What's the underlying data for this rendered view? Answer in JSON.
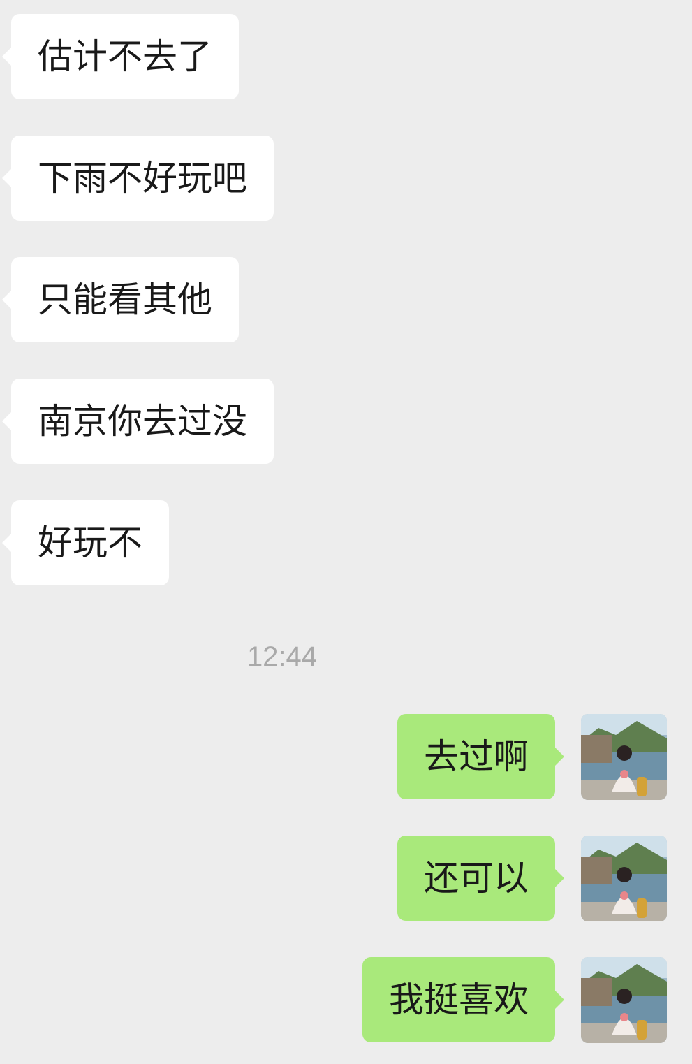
{
  "messages_incoming": [
    {
      "text": "估计不去了"
    },
    {
      "text": "下雨不好玩吧"
    },
    {
      "text": "只能看其他"
    },
    {
      "text": "南京你去过没"
    },
    {
      "text": "好玩不"
    }
  ],
  "timestamp": "12:44",
  "messages_outgoing": [
    {
      "text": "去过啊"
    },
    {
      "text": "还可以"
    },
    {
      "text": "我挺喜欢"
    }
  ],
  "colors": {
    "background": "#ededed",
    "incoming_bubble": "#ffffff",
    "outgoing_bubble": "#a9e97b",
    "timestamp_text": "#a9a9a9"
  }
}
